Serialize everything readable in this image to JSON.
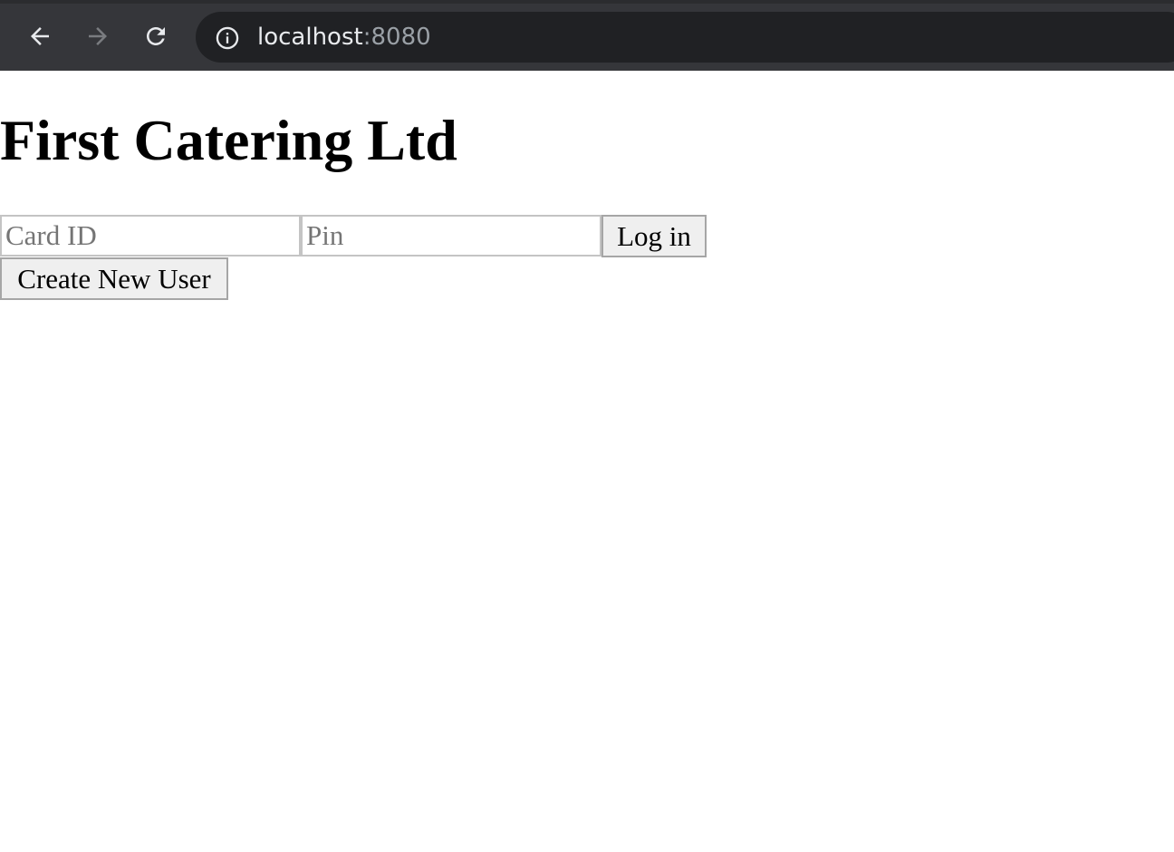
{
  "browser": {
    "url_host": "localhost",
    "url_port": ":8080"
  },
  "page": {
    "title": "First Catering Ltd",
    "card_id_placeholder": "Card ID",
    "card_id_value": "",
    "pin_placeholder": "Pin",
    "pin_value": "",
    "login_label": "Log in",
    "create_user_label": "Create New User"
  },
  "icons": {
    "back": "arrow-left-icon",
    "forward": "arrow-right-icon",
    "reload": "reload-icon",
    "site_info": "info-icon"
  },
  "colors": {
    "browser_bar": "#35363a",
    "address_bar": "#202124",
    "button_bg": "#efefef"
  }
}
